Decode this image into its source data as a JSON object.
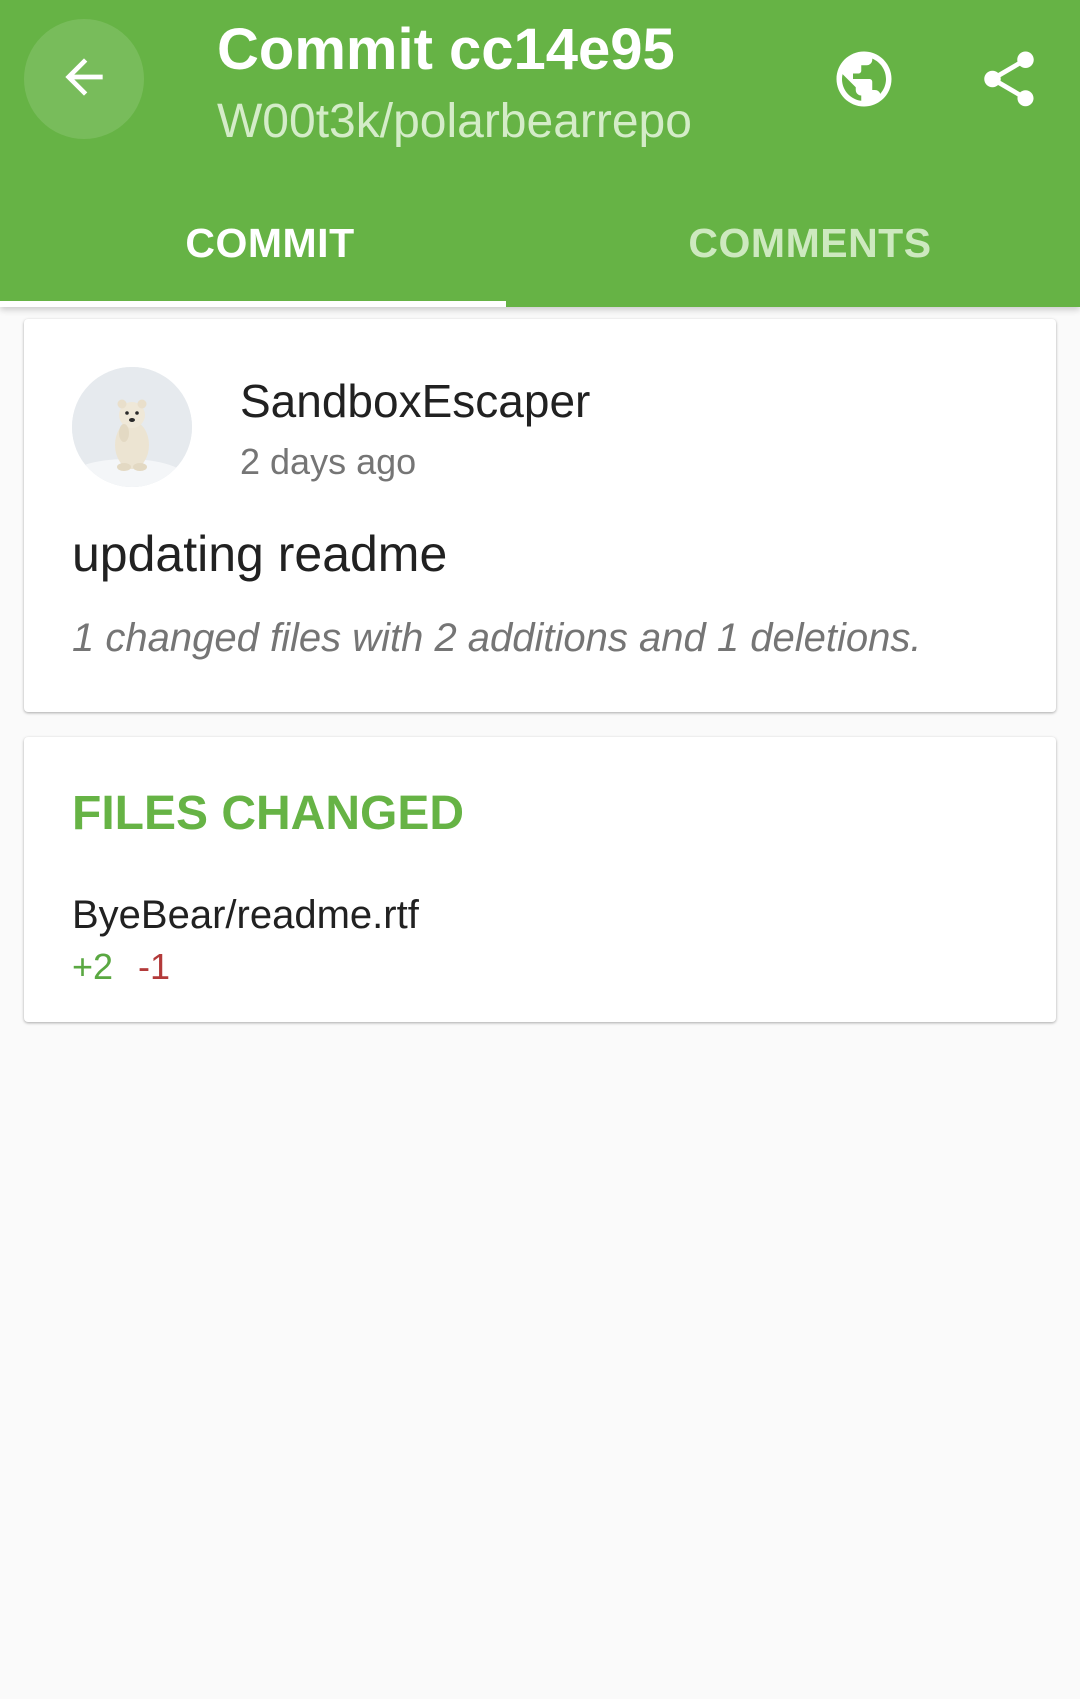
{
  "appbar": {
    "title": "Commit cc14e95",
    "subtitle": "W00t3k/polarbearrepo",
    "background_color": "#66b345",
    "icons": {
      "back": "arrow-back-icon",
      "globe": "globe-icon",
      "share": "share-icon"
    }
  },
  "tabs": [
    {
      "label": "COMMIT",
      "active": true
    },
    {
      "label": "COMMENTS",
      "active": false
    }
  ],
  "commit": {
    "author": "SandboxEscaper",
    "time": "2 days ago",
    "message": "updating readme",
    "stats": "1 changed files with 2 additions and 1 deletions."
  },
  "files_changed": {
    "heading": "FILES CHANGED",
    "heading_color": "#66b345",
    "files": [
      {
        "name": "ByeBear/readme.rtf",
        "additions": "+2",
        "deletions": "-1"
      }
    ],
    "additions_color": "#5aa842",
    "deletions_color": "#b33a3a"
  }
}
